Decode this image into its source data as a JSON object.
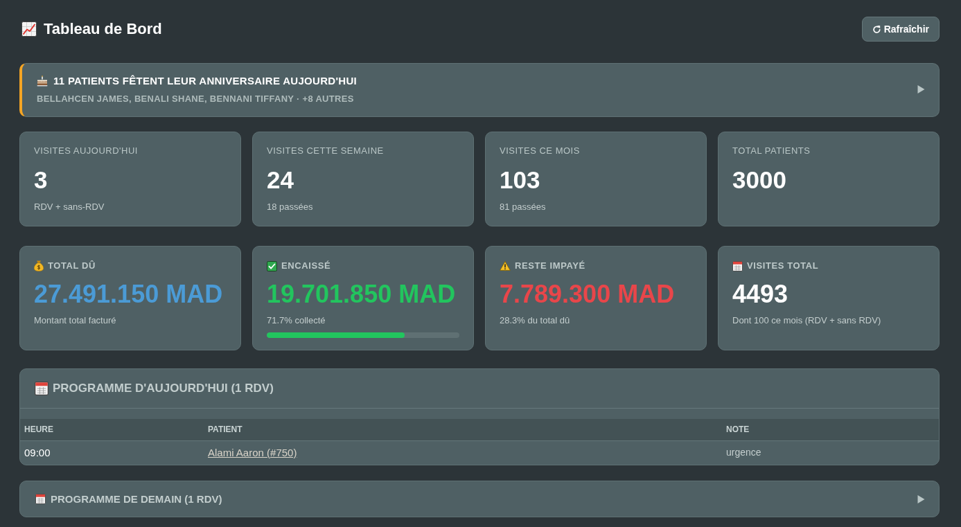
{
  "header": {
    "title": "Tableau de Bord",
    "refresh_button": {
      "label": "Rafraîchir"
    }
  },
  "birthday_banner": {
    "title": "11 PATIENTS FÊTENT LEUR ANNIVERSAIRE AUJOURD'HUI",
    "names": "BELLAHCEN JAMES, BENALI SHANE, BENNANI TIFFANY · +8 AUTRES",
    "expanded": false
  },
  "visit_stats": [
    {
      "label": "VISITES AUJOURD'HUI",
      "value": "3",
      "caption": "RDV + sans-RDV"
    },
    {
      "label": "VISITES CETTE SEMAINE",
      "value": "24",
      "caption": "18 passées"
    },
    {
      "label": "VISITES CE MOIS",
      "value": "103",
      "caption": "81 passées"
    },
    {
      "label": "TOTAL PATIENTS",
      "value": "3000"
    }
  ],
  "finance_stats": [
    {
      "kind": "money",
      "label": "TOTAL DÛ",
      "value": "27.491.150 MAD",
      "color": "#4b9bd6",
      "caption": "Montant total facturé"
    },
    {
      "kind": "check",
      "label": "ENCAISSÉ",
      "value": "19.701.850 MAD",
      "color": "#22c55e",
      "caption": "71.7% collecté",
      "level": 0.717
    },
    {
      "kind": "warning",
      "label": "RESTE IMPAYÉ",
      "value": "7.789.300 MAD",
      "color": "#e8464a",
      "caption": "28.3% du total dû"
    },
    {
      "kind": "calendar",
      "label": "VISITES TOTAL",
      "value": "4493",
      "color": "#ffffff",
      "caption": "Dont 100 ce mois (RDV + sans RDV)"
    }
  ],
  "schedules": [
    {
      "title": "PROGRAMME D'AUJOURD'HUI (1 RDV)",
      "expanded": true,
      "columns": [
        "HEURE",
        "PATIENT",
        "NOTE"
      ],
      "rows": [
        {
          "time": "09:00",
          "patient": "Alami Aaron (#750)",
          "note": "urgence"
        }
      ]
    },
    {
      "title": "PROGRAMME DE DEMAIN (1 RDV)",
      "expanded": false
    }
  ]
}
